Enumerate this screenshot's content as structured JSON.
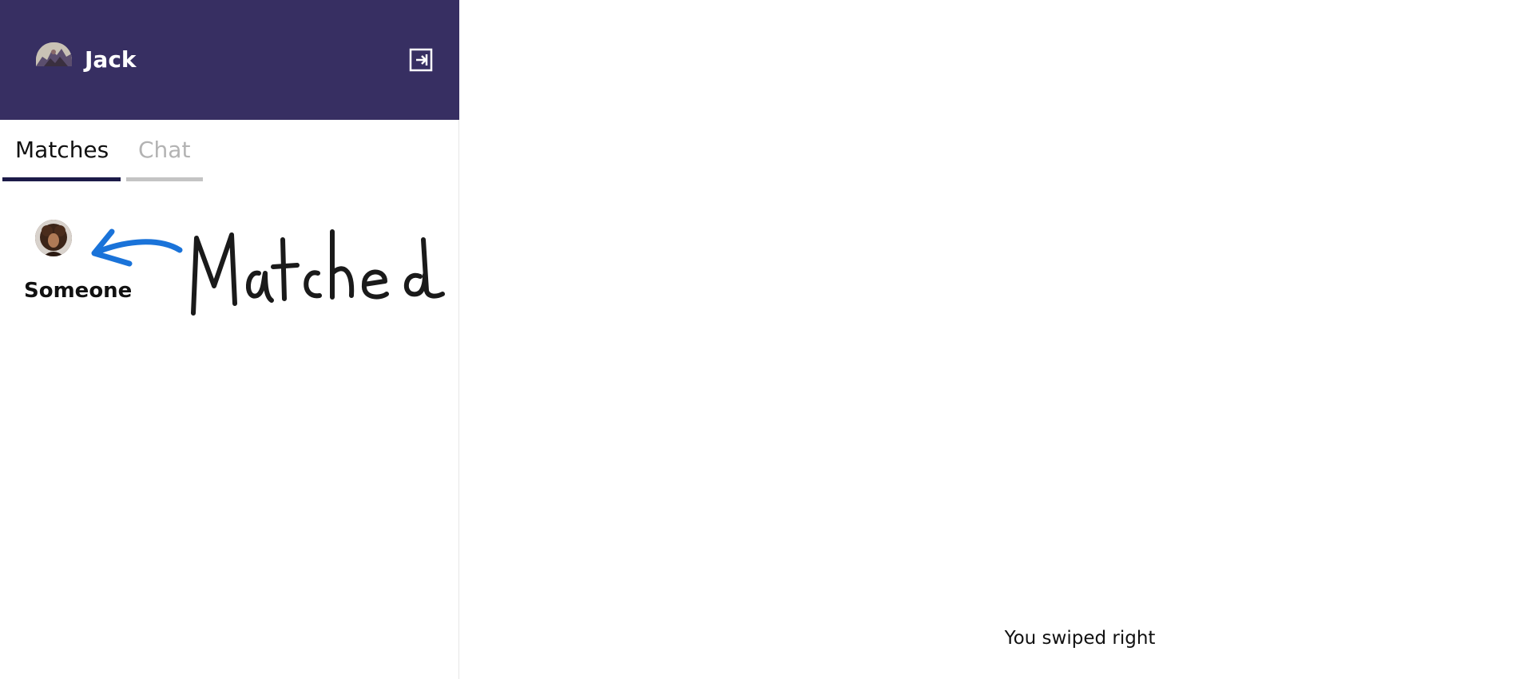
{
  "header": {
    "username": "Jack",
    "avatar_icon": "user-avatar-photo",
    "logout_icon": "logout-icon",
    "background": "#372f62"
  },
  "tabs": [
    {
      "label": "Matches",
      "active": true
    },
    {
      "label": "Chat",
      "active": false
    }
  ],
  "matches": [
    {
      "name": "Someone",
      "avatar_icon": "match-avatar-photo"
    }
  ],
  "annotation": {
    "handwritten_text": "Matched",
    "arrow_color": "#1a73d9"
  },
  "main": {
    "status_text": "You swiped right"
  }
}
